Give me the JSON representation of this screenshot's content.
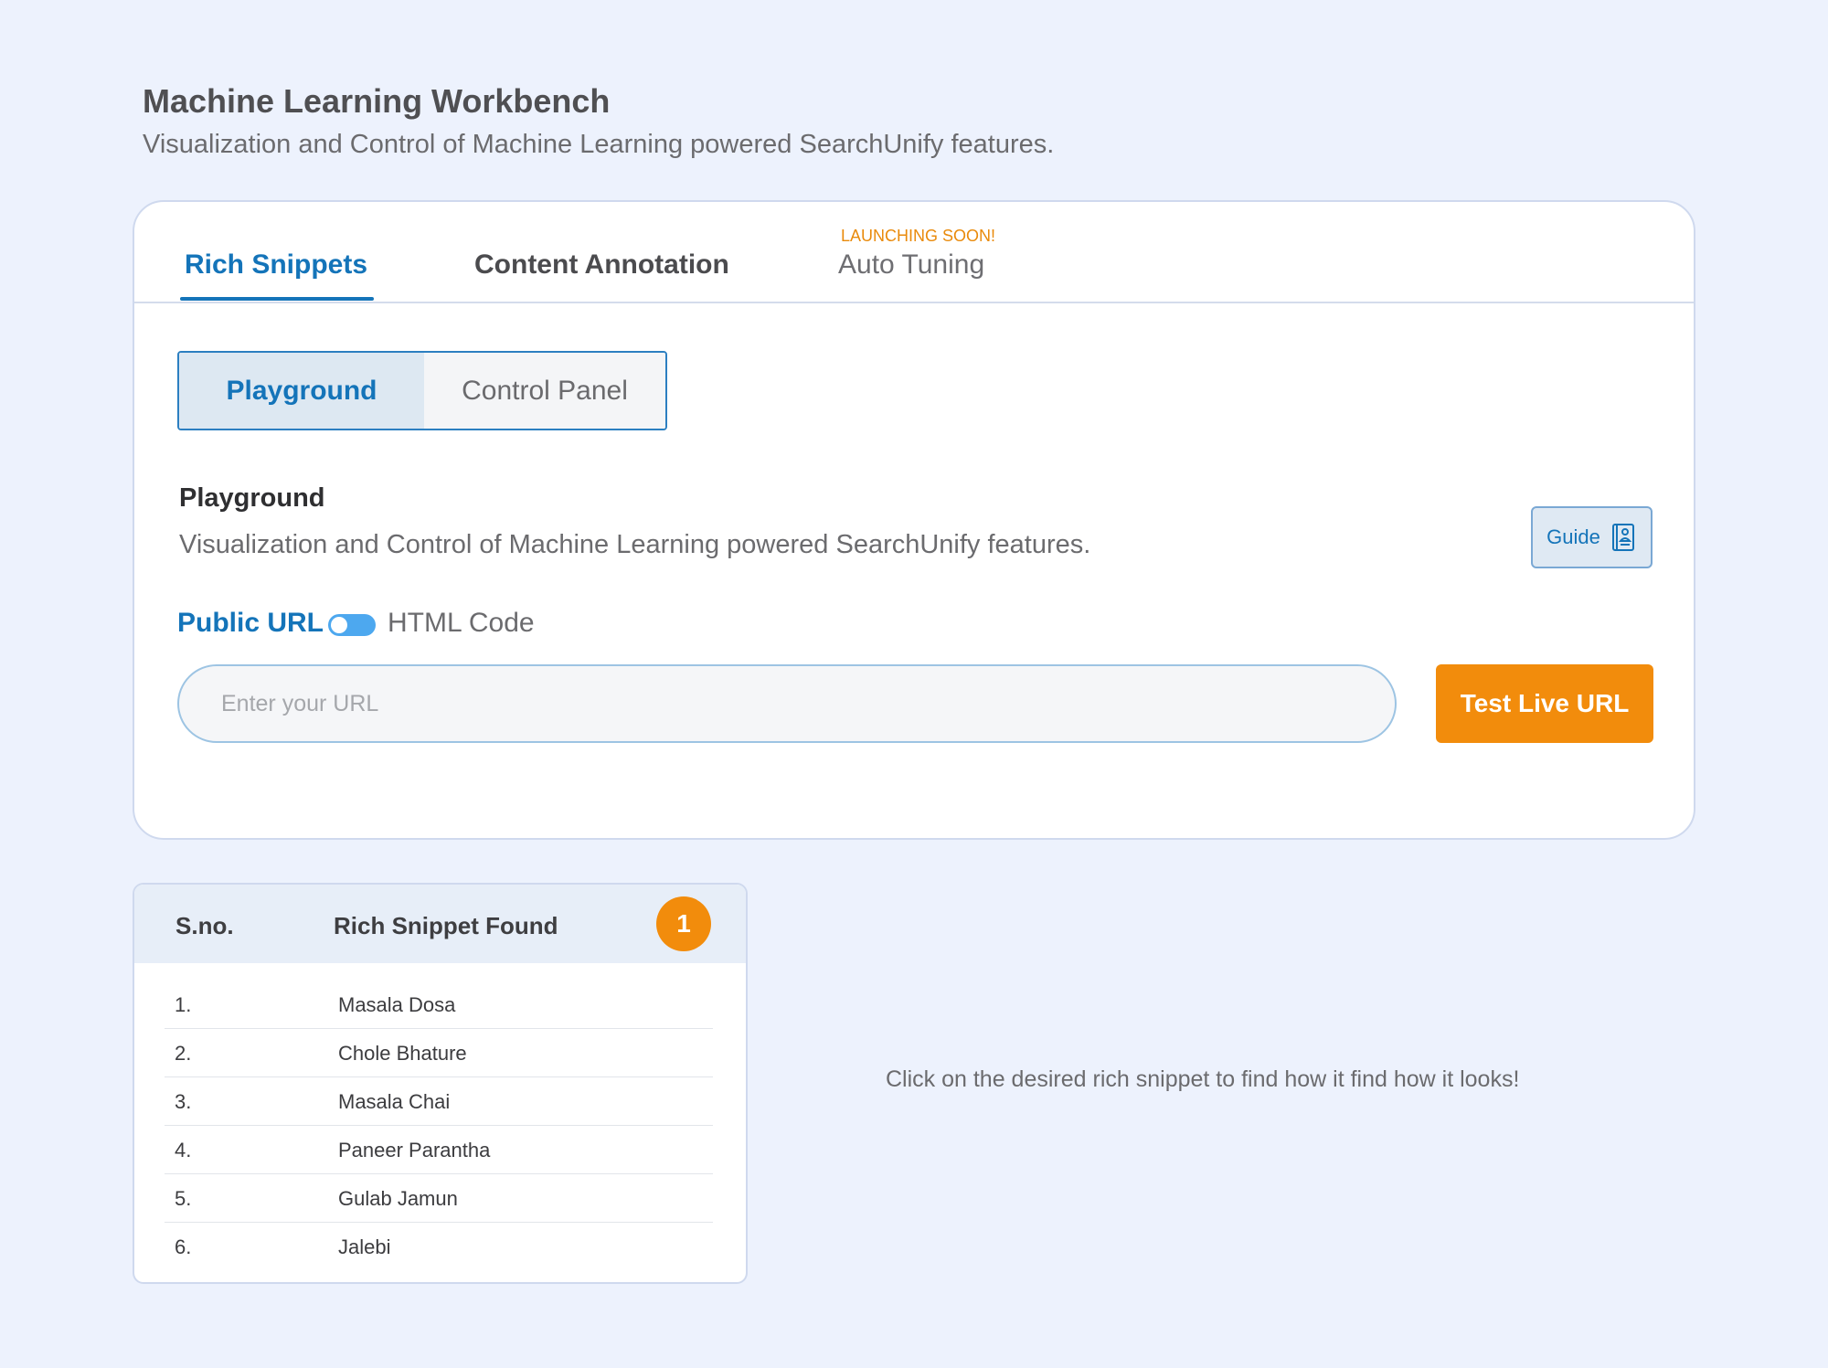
{
  "header": {
    "title": "Machine Learning Workbench",
    "subtitle": "Visualization and Control of Machine Learning powered SearchUnify features."
  },
  "tabs": [
    {
      "label": "Rich Snippets",
      "active": true
    },
    {
      "label": "Content Annotation",
      "active": false
    },
    {
      "label": "Auto Tuning",
      "active": false,
      "badge": "LAUNCHING SOON!"
    }
  ],
  "segmented": {
    "playground": "Playground",
    "control_panel": "Control Panel",
    "active": "Playground"
  },
  "section": {
    "title": "Playground",
    "description": "Visualization and Control of Machine Learning powered SearchUnify features."
  },
  "guide": {
    "label": "Guide",
    "icon": "book-icon"
  },
  "toggle": {
    "left_label": "Public URL",
    "right_label": "HTML Code",
    "selected": "Public URL"
  },
  "url_input": {
    "placeholder": "Enter your URL",
    "value": ""
  },
  "test_button": {
    "label": "Test Live URL"
  },
  "snippets": {
    "col_sno": "S.no.",
    "col_found": "Rich Snippet Found",
    "count": "1",
    "rows": [
      {
        "no": "1.",
        "name": "Masala Dosa"
      },
      {
        "no": "2.",
        "name": "Chole Bhature"
      },
      {
        "no": "3.",
        "name": "Masala Chai"
      },
      {
        "no": "4.",
        "name": "Paneer Parantha"
      },
      {
        "no": "5.",
        "name": "Gulab Jamun"
      },
      {
        "no": "6.",
        "name": "Jalebi"
      }
    ]
  },
  "hint": "Click on the desired rich snippet to find how it  find how it looks!",
  "colors": {
    "background": "#edf2fd",
    "accent_blue": "#1474b9",
    "accent_orange": "#f28c0c",
    "toggle_blue": "#4da8ef"
  }
}
